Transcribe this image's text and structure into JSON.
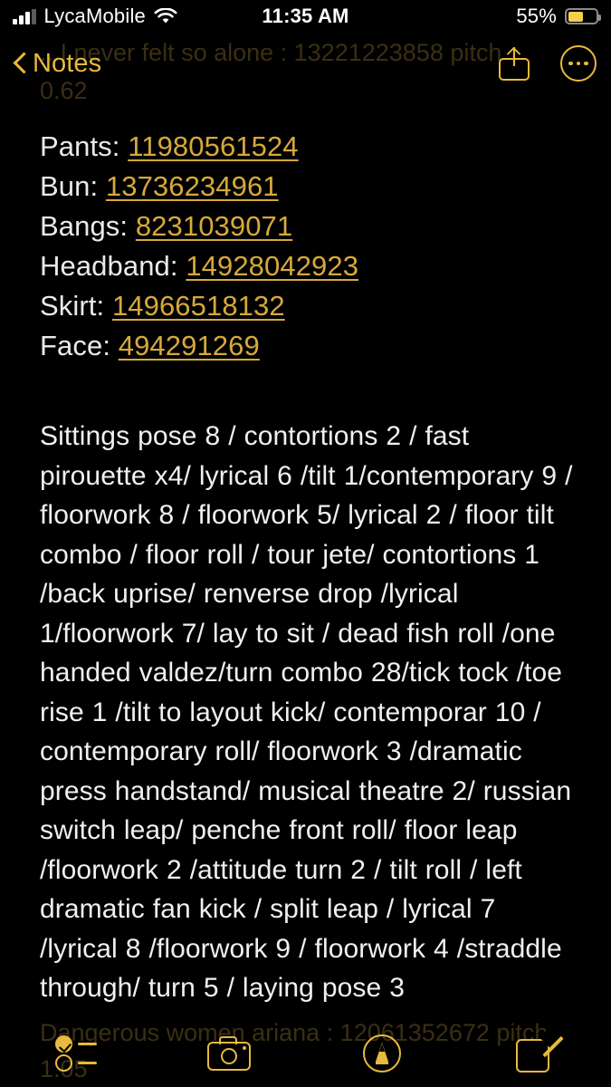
{
  "status_bar": {
    "carrier": "LycaMobile",
    "time": "11:35 AM",
    "battery_percent": "55%",
    "signal_bars_filled": 3,
    "signal_bars_total": 4,
    "battery_fill_color": "#f5cf4a",
    "wifi_icon": "wifi-icon"
  },
  "nav_bar": {
    "back_label": "Notes",
    "back_icon": "chevron-left-icon",
    "share_icon": "share-icon",
    "more_icon": "ellipsis-circle-icon",
    "accent_color": "#e8b93c"
  },
  "ghost_text": {
    "top_line_1": "...I never felt so alone : 13221223858 pitch",
    "top_line_2": "0.62",
    "bottom_line_1": "Dangerous women ariana : 12061352672 pitch",
    "bottom_line_2": "1.05"
  },
  "note": {
    "items": [
      {
        "label": "Pants: ",
        "value": "11980561524"
      },
      {
        "label": "Bun: ",
        "value": "13736234961"
      },
      {
        "label": "Bangs: ",
        "value": "8231039071"
      },
      {
        "label": "Headband: ",
        "value": "14928042923"
      },
      {
        "label": "Skirt: ",
        "value": "14966518132"
      },
      {
        "label": "Face: ",
        "value": "494291269"
      }
    ],
    "body": "Sittings pose 8 / contortions 2 / fast pirouette x4/ lyrical 6 /tilt 1/contemporary 9 / floorwork 8 / floorwork 5/ lyrical 2 / floor tilt combo / floor roll / tour jete/ contortions 1 /back uprise/ renverse drop /lyrical 1/floorwork 7/ lay to sit / dead fish roll /one handed valdez/turn combo 28/tick tock /toe rise 1 /tilt to layout kick/ contemporar 10 / contemporary roll/ floorwork 3 /dramatic press handstand/ musical theatre 2/ russian switch leap/ penche front roll/ floor leap /floorwork 2 /attitude turn 2 / tilt roll / left dramatic fan kick / split leap / lyrical 7 /lyrical 8 /floorwork 9 / floorwork 4 /straddle through/ turn 5 / laying pose 3",
    "text_color": "#f0f0f0",
    "link_color": "#d7a93a"
  },
  "toolbar": {
    "checklist_icon": "checklist-icon",
    "camera_icon": "camera-icon",
    "markup_icon": "markup-pen-icon",
    "compose_icon": "compose-icon"
  }
}
